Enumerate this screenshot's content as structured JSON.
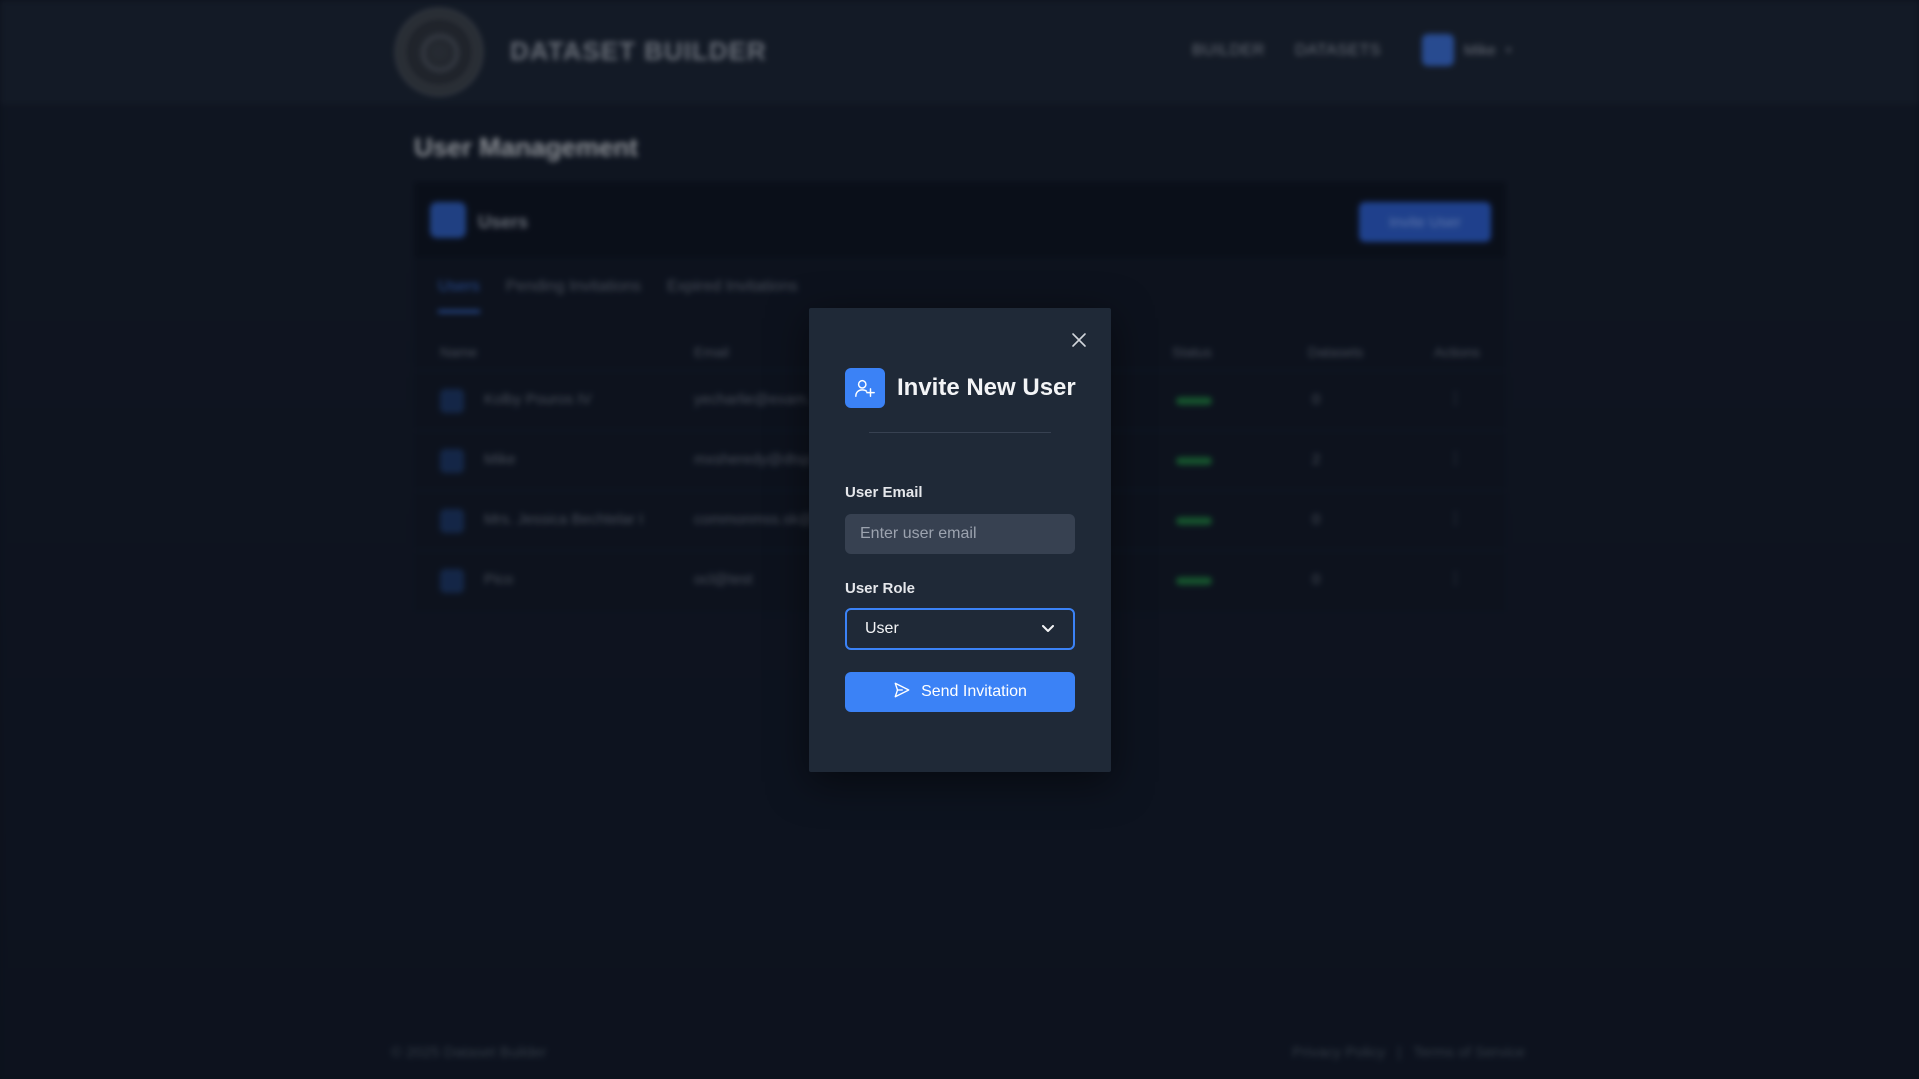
{
  "app": {
    "brand": "DATASET BUILDER",
    "nav": {
      "builder": "BUILDER",
      "datasets": "DATASETS"
    },
    "user_menu": {
      "name": "Mike"
    }
  },
  "page": {
    "title": "User Management",
    "panel_title": "Users",
    "invite_button": "Invite User",
    "tabs": [
      "Users",
      "Pending Invitations",
      "Expired Invitations"
    ],
    "columns": [
      "Name",
      "Email",
      "Status",
      "Datasets",
      "Actions"
    ],
    "rows": [
      {
        "name": "Kolby Pouros IV",
        "email": "yecharlie@exam...",
        "datasets": "0"
      },
      {
        "name": "Mike",
        "email": "mxsheredy@dtsp...",
        "datasets": "2"
      },
      {
        "name": "Mrs. Jessica Bechtelar I",
        "email": "commonmss.sk@...",
        "datasets": "0"
      },
      {
        "name": "Pico",
        "email": "ocl@test",
        "datasets": "0"
      }
    ]
  },
  "footer": {
    "copyright": "© 2025 Dataset Builder",
    "privacy": "Privacy Policy",
    "separator": "|",
    "terms": "Terms of Service"
  },
  "modal": {
    "title": "Invite New User",
    "email_label": "User Email",
    "email_placeholder": "Enter user email",
    "email_value": "",
    "role_label": "User Role",
    "role_value": "User",
    "send_button": "Send Invitation",
    "icons": {
      "close": "close-icon",
      "header": "user-plus-icon",
      "caret": "chevron-down-icon",
      "send": "send-icon"
    },
    "colors": {
      "accent": "#3b82f6",
      "modal_bg": "#1f2937",
      "input_bg": "#374151"
    }
  }
}
